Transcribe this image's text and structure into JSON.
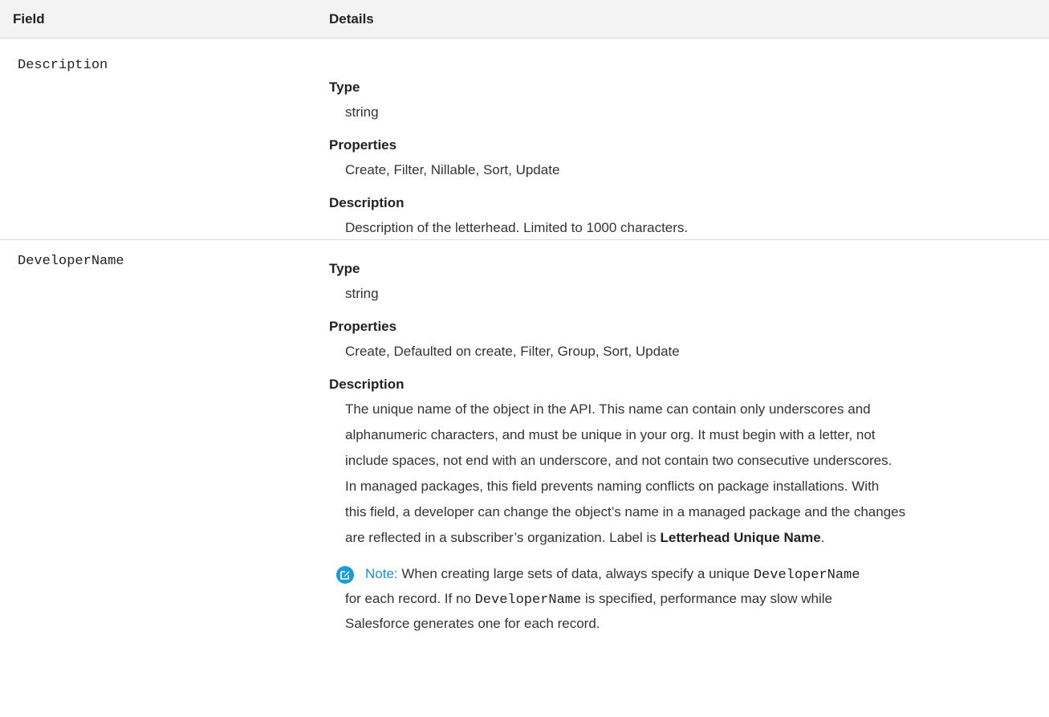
{
  "header": {
    "field": "Field",
    "details": "Details"
  },
  "rows": [
    {
      "field": "Description",
      "type_label": "Type",
      "type_value": "string",
      "properties_label": "Properties",
      "properties_value": "Create, Filter, Nillable, Sort, Update",
      "description_label": "Description",
      "description_value": "Description of the letterhead. Limited to 1000 characters."
    },
    {
      "field": "DeveloperName",
      "type_label": "Type",
      "type_value": "string",
      "properties_label": "Properties",
      "properties_value": "Create, Defaulted on create, Filter, Group, Sort, Update",
      "description_label": "Description",
      "description_lines": [
        "The unique name of the object in the API. This name can contain only underscores and",
        "alphanumeric characters, and must be unique in your org. It must begin with a letter, not",
        "include spaces, not end with an underscore, and not contain two consecutive underscores.",
        "In managed packages, this field prevents naming conflicts on package installations. With",
        "this field, a developer can change the object’s name in a managed package and the changes"
      ],
      "description_last_prefix": "are reflected in a subscriber’s organization. Label is ",
      "description_last_bold": "Letterhead Unique Name",
      "description_last_suffix": ".",
      "note": {
        "title": "Note:",
        "line1_text": "When creating large sets of data, always specify a unique ",
        "line1_code": "DeveloperName",
        "line2_prefix": "for each record. If no ",
        "line2_code": "DeveloperName",
        "line2_suffix": " is specified, performance may slow while",
        "line3": "Salesforce generates one for each record."
      }
    }
  ],
  "icons": {
    "note": "edit-pencil-icon"
  },
  "colors": {
    "accent": "#1a9bd8",
    "header_bg": "#f3f3f3"
  }
}
